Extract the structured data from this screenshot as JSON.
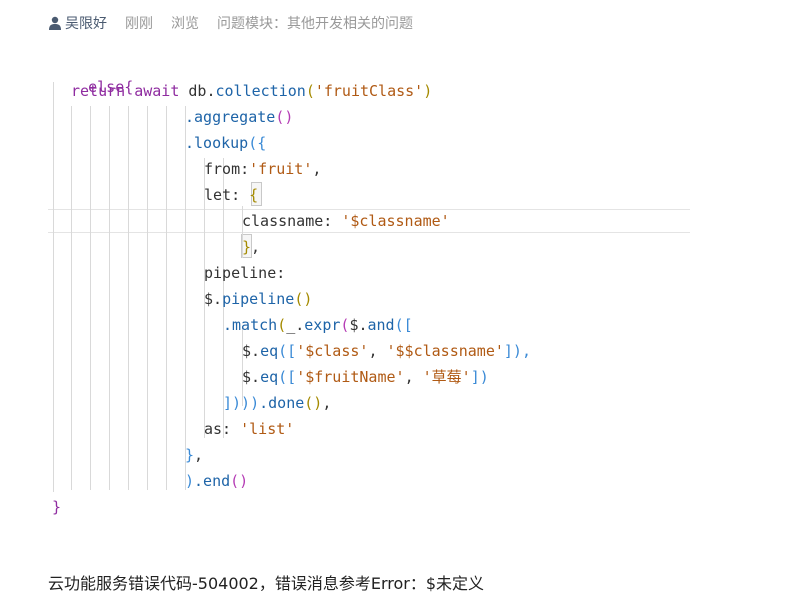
{
  "meta": {
    "author": "吴限好",
    "time": "刚刚",
    "views": "浏览",
    "module_label": "问题模块：",
    "module_value": "其他开发相关的问题"
  },
  "code": {
    "top_fragment": "else{",
    "l1_kw1": "return",
    "l1_kw2": "await",
    "l1_obj": "db.",
    "l1_fn": "collection",
    "l1_open": "(",
    "l1_str": "'fruitClass'",
    "l1_close": ")",
    "l2_fn": ".aggregate",
    "l2_paren": "()",
    "l3_fn": ".lookup",
    "l3_open": "({",
    "l4_key": "from:",
    "l4_str": "'fruit'",
    "l4_comma": ",",
    "l5_key": "let:",
    "l5_brace": "{",
    "l6_key": "classname:",
    "l6_str": "'$classname'",
    "l7_brace": "}",
    "l7_comma": ",",
    "l8_key": "pipeline:",
    "l9_obj": "$.",
    "l9_fn": "pipeline",
    "l9_paren": "()",
    "l10_fn1": ".match",
    "l10_open1": "(",
    "l10_obj1": "_.",
    "l10_fn2": "expr",
    "l10_open2": "(",
    "l10_obj2": "$.",
    "l10_fn3": "and",
    "l10_open3": "([",
    "l11_obj": "$.",
    "l11_fn": "eq",
    "l11_open": "([",
    "l11_str1": "'$class'",
    "l11_sep": ", ",
    "l11_str2": "'$$classname'",
    "l11_close": "]),",
    "l12_obj": "$.",
    "l12_fn": "eq",
    "l12_open": "([",
    "l12_str1": "'$fruitName'",
    "l12_sep": ", ",
    "l12_str2": "'草莓'",
    "l12_close": "])",
    "l13_close": "])))",
    "l13_fn": ".done",
    "l13_paren": "()",
    "l13_comma": ",",
    "l14_key": "as:",
    "l14_str": "'list'",
    "l15_brace": "}",
    "l15_comma": ",",
    "l16_close": ")",
    "l16_fn": ".end",
    "l16_paren": "()",
    "l17_brace": "}"
  },
  "footer": {
    "message": "云功能服务错误代码-504002，错误消息参考Error：$未定义"
  }
}
